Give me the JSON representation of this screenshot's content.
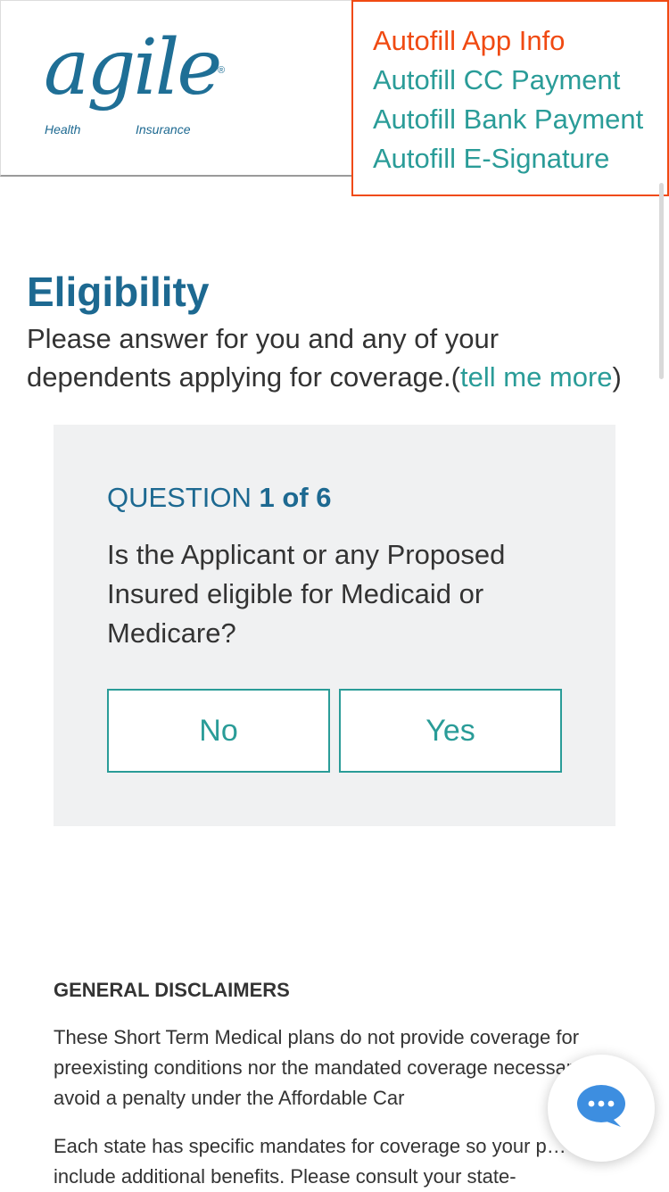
{
  "header": {
    "logo_word": "agile",
    "logo_reg": "®",
    "logo_left": "Health",
    "logo_right": "Insurance"
  },
  "autofill": {
    "items": [
      {
        "label": "Autofill App Info",
        "active": true
      },
      {
        "label": "Autofill CC Payment",
        "active": false
      },
      {
        "label": "Autofill Bank Payment",
        "active": false
      },
      {
        "label": "Autofill E-Signature",
        "active": false
      }
    ]
  },
  "page": {
    "title": "Eligibility",
    "subtitle_text": "Please answer for you and any of your dependents applying for coverage.(",
    "subtitle_link": "tell me more",
    "subtitle_close": ")"
  },
  "question": {
    "label": "QUESTION",
    "progress": "1 of 6",
    "text": "Is the Applicant or any Proposed Insured eligible for Medicaid or Medicare?",
    "no_label": "No",
    "yes_label": "Yes"
  },
  "disclaimers": {
    "heading": "GENERAL DISCLAIMERS",
    "p1": "These Short Term Medical plans do not provide coverage for preexisting conditions nor the mandated coverage necessary to avoid a penalty under the Affordable Car",
    "p2": "Each state has specific mandates for coverage so your p… may include additional benefits. Please consult your state-"
  },
  "colors": {
    "brand": "#1d6991",
    "teal": "#2a9c98",
    "accent": "#f04a12",
    "chat": "#3d8ee0"
  },
  "icons": {
    "chat": "chat-bubble-icon"
  }
}
